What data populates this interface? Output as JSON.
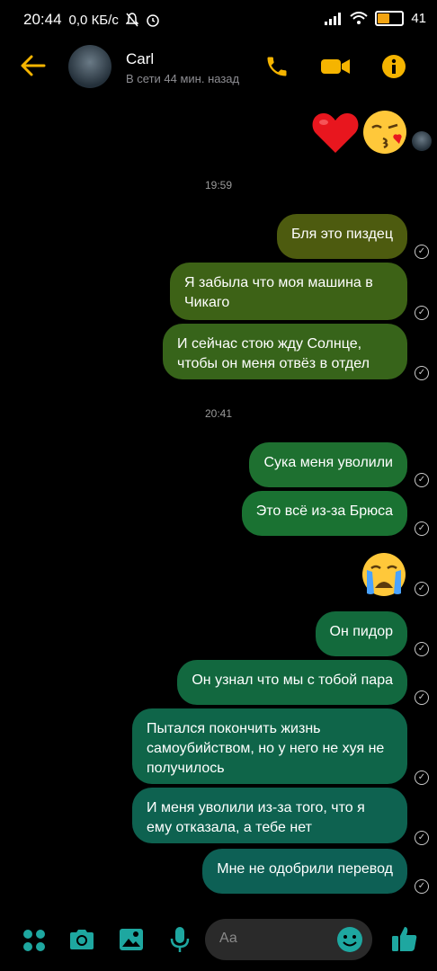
{
  "status": {
    "time": "20:44",
    "speed": "0,0 КБ/с",
    "battery": "41"
  },
  "header": {
    "name": "Carl",
    "subtitle": "В сети 44 мин. назад"
  },
  "timestamps": [
    "19:59",
    "20:41"
  ],
  "messages": [
    {
      "text": "Бля это пиздец"
    },
    {
      "text": "Я забыла что моя машина в Чикаго"
    },
    {
      "text": "И сейчас стою жду Солнце, чтобы он меня отвёз в отдел"
    },
    {
      "text": "Сука меня уволили"
    },
    {
      "text": "Это всё из-за Брюса"
    },
    {
      "text": "Он пидор"
    },
    {
      "text": "Он узнал что мы с тобой пара"
    },
    {
      "text": "Пытался покончить жизнь самоубийством, но у него не хуя не получилось"
    },
    {
      "text": "И меня уволили из-за того, что я ему отказала, а тебе нет"
    },
    {
      "text": "Мне не одобрили перевод"
    }
  ],
  "reactions": [
    "heart-emoji",
    "kiss-emoji",
    "crying-emoji"
  ],
  "composer": {
    "placeholder": "Аа"
  },
  "colors": {
    "accent": "#f5b400",
    "input_accent": "#1ea7a0",
    "bubble_top": "#4d5b0f",
    "bubble_mid": "#1d7330",
    "bubble_bottom": "#0d6055"
  }
}
